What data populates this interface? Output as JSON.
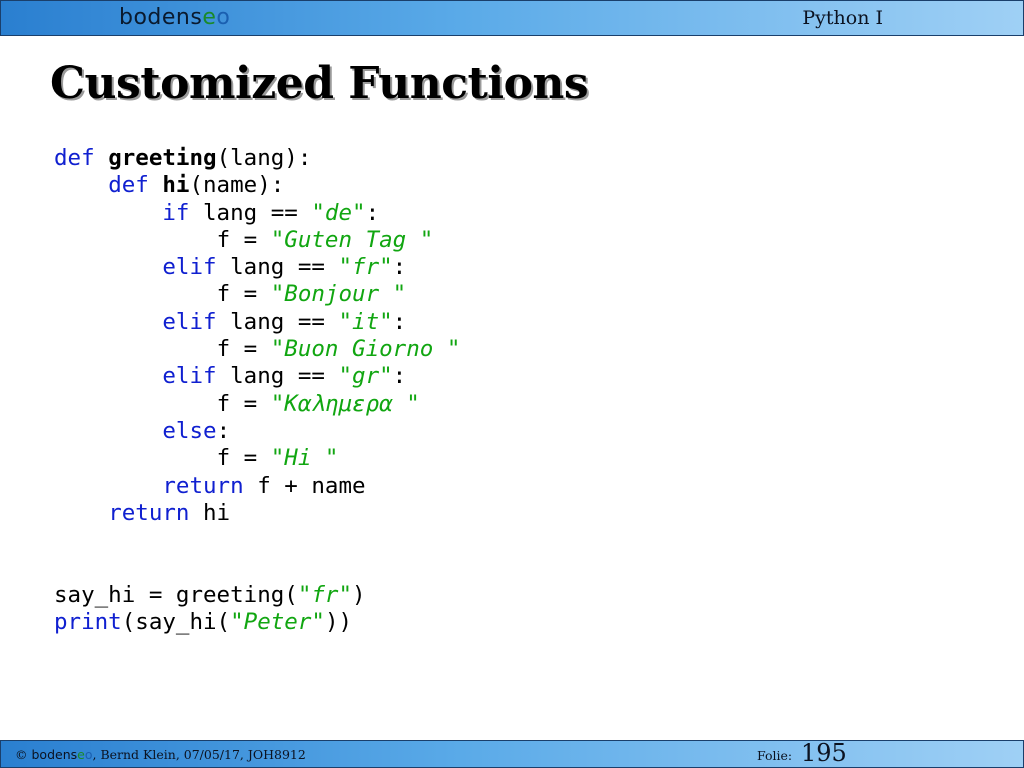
{
  "header": {
    "logo": {
      "part1": "bodens",
      "part2": "e",
      "part3": "o"
    },
    "course": "Python I"
  },
  "slide": {
    "title": "Customized Functions"
  },
  "code": {
    "l1": {
      "kw": "def",
      "fn": "greeting",
      "rest": "(lang):"
    },
    "l2": {
      "indent": "    ",
      "kw": "def",
      "fn": "hi",
      "rest": "(name):"
    },
    "l3": {
      "indent": "        ",
      "kw": "if",
      "mid": " lang == ",
      "str": "\"de\"",
      "end": ":"
    },
    "l4": {
      "indent": "            ",
      "mid": "f = ",
      "str": "\"Guten Tag \""
    },
    "l5": {
      "indent": "        ",
      "kw": "elif",
      "mid": " lang == ",
      "str": "\"fr\"",
      "end": ":"
    },
    "l6": {
      "indent": "            ",
      "mid": "f = ",
      "str": "\"Bonjour \""
    },
    "l7": {
      "indent": "        ",
      "kw": "elif",
      "mid": " lang == ",
      "str": "\"it\"",
      "end": ":"
    },
    "l8": {
      "indent": "            ",
      "mid": "f = ",
      "str": "\"Buon Giorno \""
    },
    "l9": {
      "indent": "        ",
      "kw": "elif",
      "mid": " lang == ",
      "str": "\"gr\"",
      "end": ":"
    },
    "l10": {
      "indent": "            ",
      "mid": "f = ",
      "str": "\"Καλημερα \""
    },
    "l11": {
      "indent": "        ",
      "kw": "else",
      "end": ":"
    },
    "l12": {
      "indent": "            ",
      "mid": "f = ",
      "str": "\"Hi \""
    },
    "l13": {
      "indent": "        ",
      "kw": "return",
      "mid": " f + name"
    },
    "l14": {
      "indent": "    ",
      "kw": "return",
      "mid": " hi"
    },
    "l17": {
      "a": "say_hi = greeting(",
      "str": "\"fr\"",
      "end": ")"
    },
    "l18": {
      "kw": "print",
      "a": "(say_hi(",
      "str": "\"Peter\"",
      "end": "))"
    }
  },
  "footer": {
    "copyright": "© ",
    "brand": {
      "part1": "bodens",
      "part2": "e",
      "part3": "o"
    },
    "credit": ", Bernd Klein, 07/05/17, JOH8912",
    "folie_label": "Folie:",
    "folie_number": "195"
  }
}
